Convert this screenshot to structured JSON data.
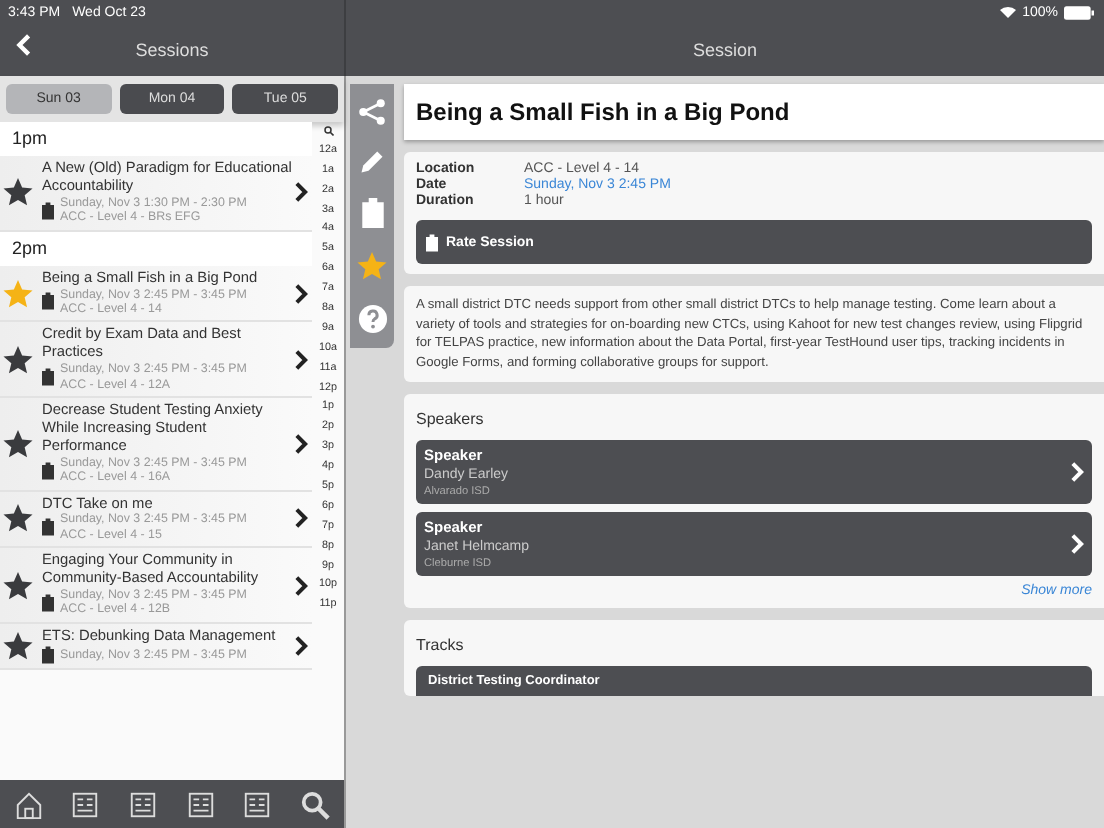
{
  "status_bar": {
    "time": "3:43 PM",
    "date": "Wed Oct 23",
    "battery": "100%"
  },
  "sessions_panel": {
    "title": "Sessions",
    "day_tabs": [
      {
        "label": "Sun 03",
        "selected": true
      },
      {
        "label": "Mon 04",
        "selected": false
      },
      {
        "label": "Tue 05",
        "selected": false
      }
    ],
    "sections": [
      {
        "heading": "1pm",
        "sessions": [
          {
            "title": "A New (Old) Paradigm for Educational Accountability",
            "starred": false,
            "time": "Sunday, Nov 3 1:30 PM - 2:30 PM",
            "location": "ACC - Level 4 - BRs EFG"
          }
        ]
      },
      {
        "heading": "2pm",
        "sessions": [
          {
            "title": "Being a Small Fish in a Big Pond",
            "starred": true,
            "time": "Sunday, Nov 3 2:45 PM - 3:45 PM",
            "location": "ACC - Level 4 - 14"
          },
          {
            "title": "Credit by Exam Data and Best Practices",
            "starred": false,
            "time": "Sunday, Nov 3 2:45 PM - 3:45 PM",
            "location": "ACC - Level 4 - 12A"
          },
          {
            "title": "Decrease Student Testing Anxiety While Increasing Student Performance",
            "starred": false,
            "time": "Sunday, Nov 3 2:45 PM - 3:45 PM",
            "location": "ACC - Level 4 - 16A"
          },
          {
            "title": "DTC Take on me",
            "starred": false,
            "time": "Sunday, Nov 3 2:45 PM - 3:45 PM",
            "location": "ACC - Level 4 - 15"
          },
          {
            "title": "Engaging Your Community in Community-Based Accountability",
            "starred": false,
            "time": "Sunday, Nov 3 2:45 PM - 3:45 PM",
            "location": "ACC - Level 4 - 12B"
          },
          {
            "title": "ETS: Debunking Data Management",
            "starred": false,
            "time": "Sunday, Nov 3 2:45 PM - 3:45 PM"
          }
        ]
      }
    ],
    "index": [
      "12a",
      "1a",
      "2a",
      "3a",
      "4a",
      "5a",
      "6a",
      "7a",
      "8a",
      "9a",
      "10a",
      "11a",
      "12p",
      "1p",
      "2p",
      "3p",
      "4p",
      "5p",
      "6p",
      "7p",
      "8p",
      "9p",
      "10p",
      "11p"
    ]
  },
  "session": {
    "nav_title": "Session",
    "starred": true,
    "title": "Being a Small Fish in a Big Pond",
    "details": [
      {
        "label": "Location",
        "value": "ACC - Level 4 - 14",
        "kind": "text"
      },
      {
        "label": "Date",
        "value": "Sunday, Nov 3 2:45 PM",
        "kind": "link"
      },
      {
        "label": "Duration",
        "value": "1 hour",
        "kind": "text"
      }
    ],
    "rate_button": "Rate Session",
    "description": "A small district DTC needs support from other small district DTCs to help manage testing. Come learn about a variety of tools and strategies for on-boarding new CTCs, using Kahoot for new test changes review, using Flipgrid for TELPAS practice, new information about the Data Portal, first-year TestHound user tips, tracking incidents in Google Forms, and forming collaborative groups for support.",
    "speakers_heading": "Speakers",
    "speakers": [
      {
        "role": "Speaker",
        "name": "Dandy Earley",
        "org": "Alvarado ISD"
      },
      {
        "role": "Speaker",
        "name": "Janet Helmcamp",
        "org": "Cleburne ISD"
      }
    ],
    "show_more": "Show more",
    "tracks_heading": "Tracks",
    "tracks": [
      "District Testing Coordinator"
    ]
  }
}
